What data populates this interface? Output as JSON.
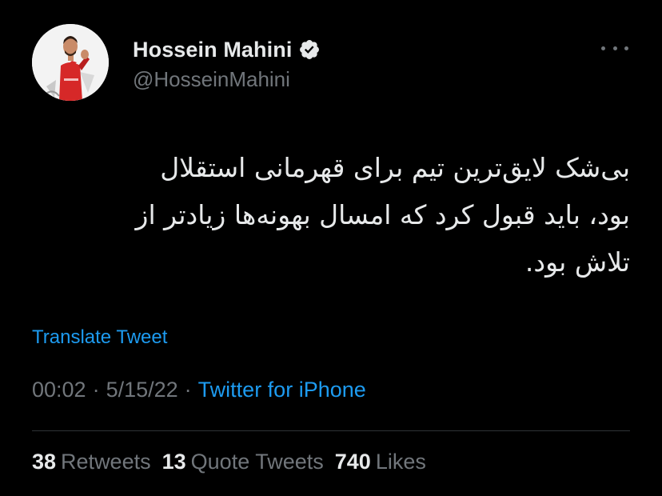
{
  "author": {
    "display_name": "Hossein Mahini",
    "handle": "@HosseinMahini",
    "verified": true
  },
  "icons": {
    "verified": "verified-badge-icon",
    "more": "more-options-icon"
  },
  "tweet": {
    "text": "بی‌شک لایق‌ترین تیم برای قهرمانی استقلال\nبود، باید قبول کرد که امسال بهونه‌ها زیادتر از\nتلاش بود.",
    "translate_label": "Translate Tweet",
    "time": "00:02",
    "date": "5/15/22",
    "separator": "·",
    "source": "Twitter for iPhone"
  },
  "stats": {
    "retweets_count": "38",
    "retweets_label": "Retweets",
    "quotes_count": "13",
    "quotes_label": "Quote Tweets",
    "likes_count": "740",
    "likes_label": "Likes"
  },
  "colors": {
    "background": "#000000",
    "text_primary": "#e7e9ea",
    "text_secondary": "#71767b",
    "accent": "#1d9bf0",
    "divider": "#2f3336"
  }
}
